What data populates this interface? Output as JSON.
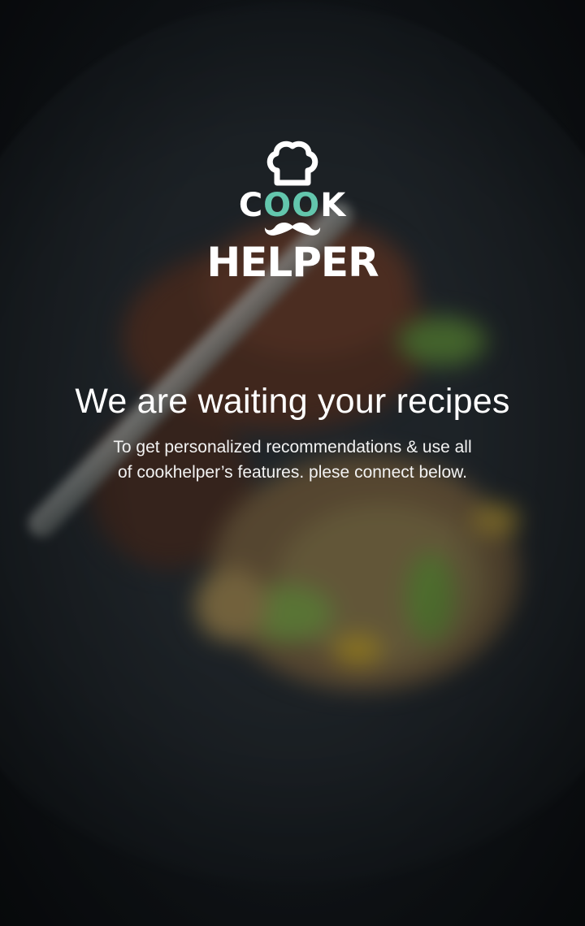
{
  "logo": {
    "line1_parts": [
      "C",
      "OO",
      "K"
    ],
    "line2": "HELPER",
    "icons": [
      "chef-hat-icon",
      "mustache-icon"
    ],
    "accent_color": "#63c6ad"
  },
  "welcome": {
    "headline": "We are waiting your recipes",
    "subtitle_line1": "To get personalized recommendations & use all",
    "subtitle_line2": "of cookhelper’s features. plese connect below."
  },
  "colors": {
    "text": "#ffffff",
    "background": "#1d2328",
    "accent": "#63c6ad"
  }
}
